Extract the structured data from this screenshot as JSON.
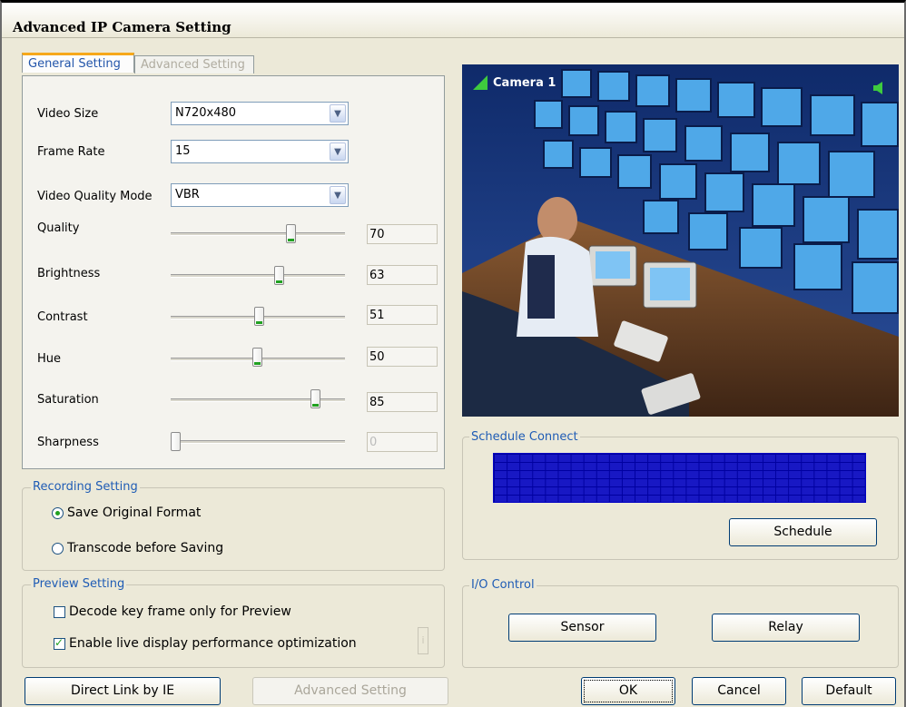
{
  "window": {
    "title": "Advanced IP Camera Setting"
  },
  "tabs": [
    {
      "label": "General Setting",
      "active": true
    },
    {
      "label": "Advanced Setting",
      "active": false
    }
  ],
  "general": {
    "video_size": {
      "label": "Video Size",
      "value": "N720x480"
    },
    "frame_rate": {
      "label": "Frame Rate",
      "value": "15"
    },
    "video_quality_mode": {
      "label": "Video Quality Mode",
      "value": "VBR"
    },
    "sliders": [
      {
        "label": "Quality",
        "value": "70",
        "level": 70
      },
      {
        "label": "Brightness",
        "value": "63",
        "level": 63
      },
      {
        "label": "Contrast",
        "value": "51",
        "level": 51
      },
      {
        "label": "Hue",
        "value": "50",
        "level": 50
      },
      {
        "label": "Saturation",
        "value": "85",
        "level": 85
      },
      {
        "label": "Sharpness",
        "value": "0",
        "level": 0,
        "disabled": true
      }
    ]
  },
  "recording": {
    "legend": "Recording Setting",
    "options": [
      {
        "label": "Save Original Format",
        "selected": true
      },
      {
        "label": "Transcode before Saving",
        "selected": false
      }
    ]
  },
  "preview": {
    "legend": "Preview Setting",
    "options": [
      {
        "label": "Decode key frame only for Preview",
        "checked": false
      },
      {
        "label": "Enable live display performance optimization",
        "checked": true
      }
    ]
  },
  "camera": {
    "label": "Camera 1"
  },
  "schedule": {
    "legend": "Schedule Connect",
    "button": "Schedule"
  },
  "io": {
    "legend": "I/O Control",
    "sensor": "Sensor",
    "relay": "Relay"
  },
  "buttons": {
    "direct_link": "Direct Link by IE",
    "advanced_setting": "Advanced Setting",
    "ok": "OK",
    "cancel": "Cancel",
    "default": "Default"
  },
  "colors": {
    "accent": "#21a121",
    "legend": "#1f5cb5",
    "dialog": "#ece9d8",
    "schedule_grid": "#1818c4"
  }
}
